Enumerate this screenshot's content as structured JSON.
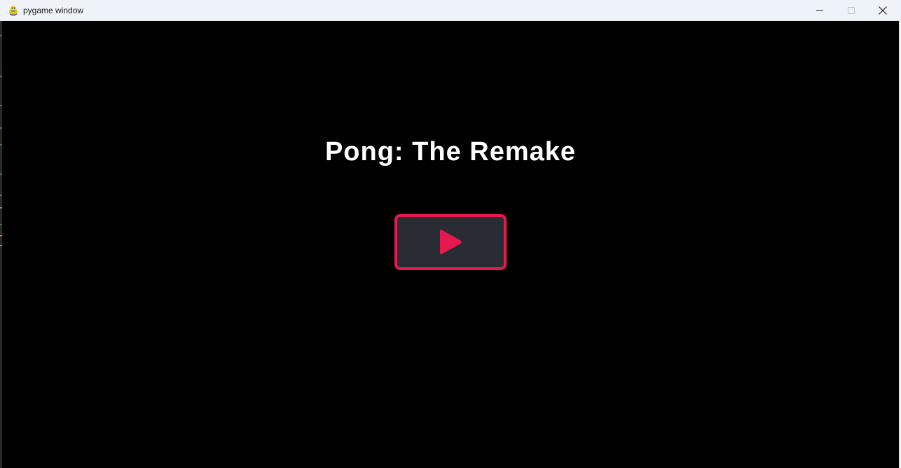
{
  "window": {
    "title": "pygame window",
    "app_icon": "pygame-snake-icon",
    "controls": {
      "minimize_icon": "minimize-icon",
      "maximize_icon": "maximize-icon",
      "close_icon": "close-icon"
    }
  },
  "game": {
    "title": "Pong: The Remake",
    "play_button": {
      "icon": "play-icon",
      "accent_color": "#e5194f",
      "fill_color": "#2a2c33"
    },
    "background_color": "#000000"
  }
}
